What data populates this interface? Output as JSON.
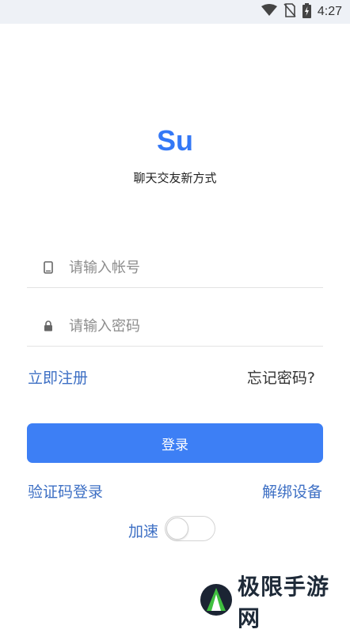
{
  "status_bar": {
    "time": "4:27"
  },
  "app": {
    "name": "Su",
    "slogan": "聊天交友新方式"
  },
  "form": {
    "account_placeholder": "请输入帐号",
    "password_placeholder": "请输入密码"
  },
  "links": {
    "register": "立即注册",
    "forgot_password": "忘记密码?",
    "sms_login": "验证码登录",
    "unbind_device": "解绑设备"
  },
  "buttons": {
    "login": "登录"
  },
  "accelerate": {
    "label": "加速",
    "enabled": false
  },
  "watermark": {
    "text": "极限手游网"
  },
  "colors": {
    "accent": "#3d7ff5",
    "brand_text": "#3478f6",
    "link": "#3d6fc4"
  }
}
